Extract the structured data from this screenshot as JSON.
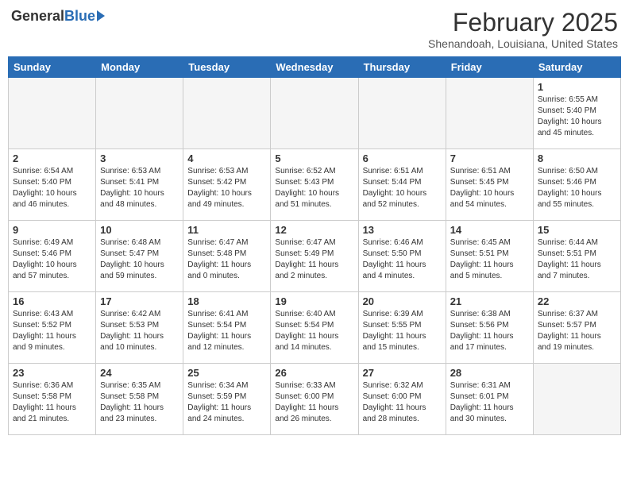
{
  "header": {
    "logo_general": "General",
    "logo_blue": "Blue",
    "month_title": "February 2025",
    "location": "Shenandoah, Louisiana, United States"
  },
  "weekdays": [
    "Sunday",
    "Monday",
    "Tuesday",
    "Wednesday",
    "Thursday",
    "Friday",
    "Saturday"
  ],
  "weeks": [
    [
      {
        "day": "",
        "info": ""
      },
      {
        "day": "",
        "info": ""
      },
      {
        "day": "",
        "info": ""
      },
      {
        "day": "",
        "info": ""
      },
      {
        "day": "",
        "info": ""
      },
      {
        "day": "",
        "info": ""
      },
      {
        "day": "1",
        "info": "Sunrise: 6:55 AM\nSunset: 5:40 PM\nDaylight: 10 hours\nand 45 minutes."
      }
    ],
    [
      {
        "day": "2",
        "info": "Sunrise: 6:54 AM\nSunset: 5:40 PM\nDaylight: 10 hours\nand 46 minutes."
      },
      {
        "day": "3",
        "info": "Sunrise: 6:53 AM\nSunset: 5:41 PM\nDaylight: 10 hours\nand 48 minutes."
      },
      {
        "day": "4",
        "info": "Sunrise: 6:53 AM\nSunset: 5:42 PM\nDaylight: 10 hours\nand 49 minutes."
      },
      {
        "day": "5",
        "info": "Sunrise: 6:52 AM\nSunset: 5:43 PM\nDaylight: 10 hours\nand 51 minutes."
      },
      {
        "day": "6",
        "info": "Sunrise: 6:51 AM\nSunset: 5:44 PM\nDaylight: 10 hours\nand 52 minutes."
      },
      {
        "day": "7",
        "info": "Sunrise: 6:51 AM\nSunset: 5:45 PM\nDaylight: 10 hours\nand 54 minutes."
      },
      {
        "day": "8",
        "info": "Sunrise: 6:50 AM\nSunset: 5:46 PM\nDaylight: 10 hours\nand 55 minutes."
      }
    ],
    [
      {
        "day": "9",
        "info": "Sunrise: 6:49 AM\nSunset: 5:46 PM\nDaylight: 10 hours\nand 57 minutes."
      },
      {
        "day": "10",
        "info": "Sunrise: 6:48 AM\nSunset: 5:47 PM\nDaylight: 10 hours\nand 59 minutes."
      },
      {
        "day": "11",
        "info": "Sunrise: 6:47 AM\nSunset: 5:48 PM\nDaylight: 11 hours\nand 0 minutes."
      },
      {
        "day": "12",
        "info": "Sunrise: 6:47 AM\nSunset: 5:49 PM\nDaylight: 11 hours\nand 2 minutes."
      },
      {
        "day": "13",
        "info": "Sunrise: 6:46 AM\nSunset: 5:50 PM\nDaylight: 11 hours\nand 4 minutes."
      },
      {
        "day": "14",
        "info": "Sunrise: 6:45 AM\nSunset: 5:51 PM\nDaylight: 11 hours\nand 5 minutes."
      },
      {
        "day": "15",
        "info": "Sunrise: 6:44 AM\nSunset: 5:51 PM\nDaylight: 11 hours\nand 7 minutes."
      }
    ],
    [
      {
        "day": "16",
        "info": "Sunrise: 6:43 AM\nSunset: 5:52 PM\nDaylight: 11 hours\nand 9 minutes."
      },
      {
        "day": "17",
        "info": "Sunrise: 6:42 AM\nSunset: 5:53 PM\nDaylight: 11 hours\nand 10 minutes."
      },
      {
        "day": "18",
        "info": "Sunrise: 6:41 AM\nSunset: 5:54 PM\nDaylight: 11 hours\nand 12 minutes."
      },
      {
        "day": "19",
        "info": "Sunrise: 6:40 AM\nSunset: 5:54 PM\nDaylight: 11 hours\nand 14 minutes."
      },
      {
        "day": "20",
        "info": "Sunrise: 6:39 AM\nSunset: 5:55 PM\nDaylight: 11 hours\nand 15 minutes."
      },
      {
        "day": "21",
        "info": "Sunrise: 6:38 AM\nSunset: 5:56 PM\nDaylight: 11 hours\nand 17 minutes."
      },
      {
        "day": "22",
        "info": "Sunrise: 6:37 AM\nSunset: 5:57 PM\nDaylight: 11 hours\nand 19 minutes."
      }
    ],
    [
      {
        "day": "23",
        "info": "Sunrise: 6:36 AM\nSunset: 5:58 PM\nDaylight: 11 hours\nand 21 minutes."
      },
      {
        "day": "24",
        "info": "Sunrise: 6:35 AM\nSunset: 5:58 PM\nDaylight: 11 hours\nand 23 minutes."
      },
      {
        "day": "25",
        "info": "Sunrise: 6:34 AM\nSunset: 5:59 PM\nDaylight: 11 hours\nand 24 minutes."
      },
      {
        "day": "26",
        "info": "Sunrise: 6:33 AM\nSunset: 6:00 PM\nDaylight: 11 hours\nand 26 minutes."
      },
      {
        "day": "27",
        "info": "Sunrise: 6:32 AM\nSunset: 6:00 PM\nDaylight: 11 hours\nand 28 minutes."
      },
      {
        "day": "28",
        "info": "Sunrise: 6:31 AM\nSunset: 6:01 PM\nDaylight: 11 hours\nand 30 minutes."
      },
      {
        "day": "",
        "info": ""
      }
    ]
  ]
}
